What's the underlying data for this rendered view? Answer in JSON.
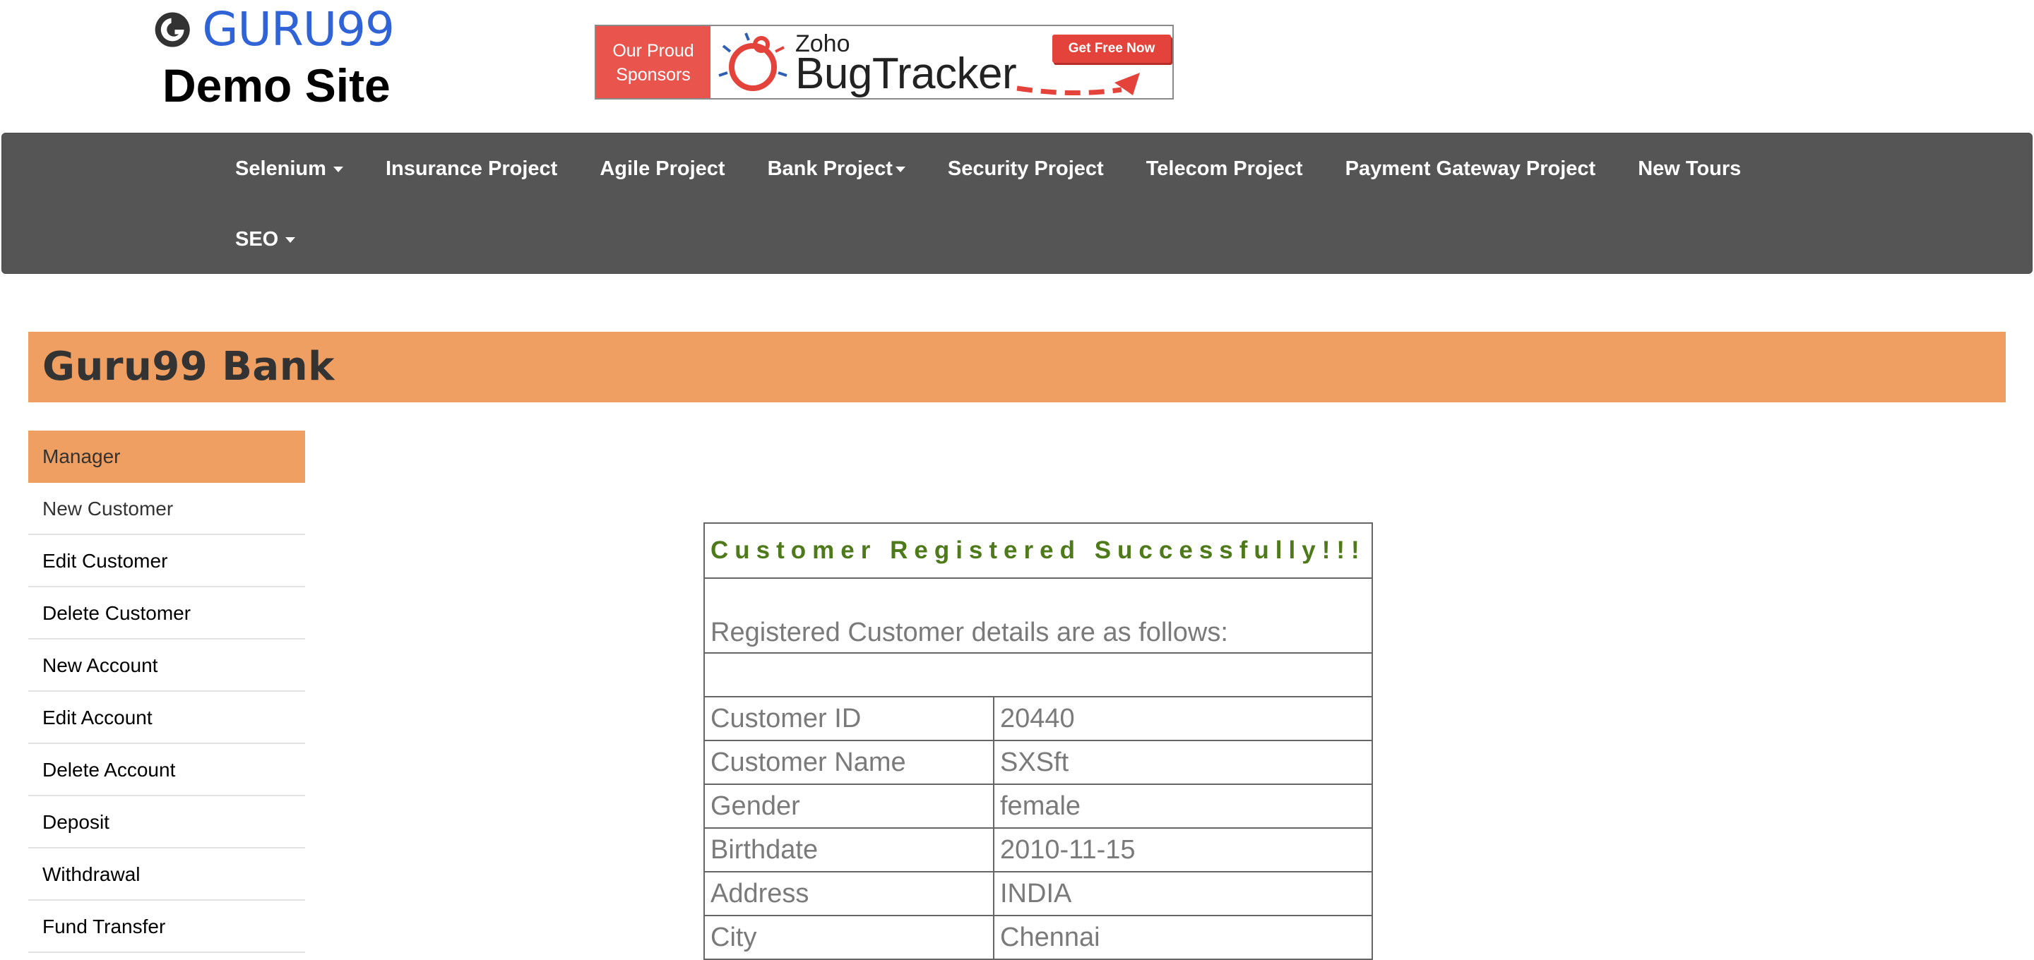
{
  "header": {
    "logo_text": "GURU99",
    "site_name": "Demo Site"
  },
  "banner": {
    "line1": "Our Proud",
    "line2": "Sponsors",
    "brand": "Zoho",
    "product": "BugTracker",
    "cta": "Get Free Now",
    "accent_color": "#e9554d"
  },
  "navbar": {
    "items": [
      {
        "label": "Selenium",
        "has_dropdown": true
      },
      {
        "label": "Insurance Project",
        "has_dropdown": false
      },
      {
        "label": "Agile Project",
        "has_dropdown": false
      },
      {
        "label": "Bank Project",
        "has_dropdown": true
      },
      {
        "label": "Security Project",
        "has_dropdown": false
      },
      {
        "label": "Telecom Project",
        "has_dropdown": false
      },
      {
        "label": "Payment Gateway Project",
        "has_dropdown": false
      },
      {
        "label": "New Tours",
        "has_dropdown": false
      },
      {
        "label": "SEO",
        "has_dropdown": true
      }
    ],
    "background": "#555555"
  },
  "bank": {
    "title": "Guru99 Bank",
    "color": "#ee9f61"
  },
  "sidebar": {
    "items": [
      {
        "label": "Manager"
      },
      {
        "label": "New Customer"
      },
      {
        "label": "Edit Customer"
      },
      {
        "label": "Delete Customer"
      },
      {
        "label": "New Account"
      },
      {
        "label": "Edit Account"
      },
      {
        "label": "Delete Account"
      },
      {
        "label": "Deposit"
      },
      {
        "label": "Withdrawal"
      },
      {
        "label": "Fund Transfer"
      }
    ]
  },
  "result": {
    "heading": "Customer Registered Successfully!!!",
    "intro": "Registered Customer details are as follows:",
    "rows": [
      {
        "label": "Customer ID",
        "value": "20440"
      },
      {
        "label": "Customer Name",
        "value": "SXSft"
      },
      {
        "label": "Gender",
        "value": "female"
      },
      {
        "label": "Birthdate",
        "value": "2010-11-15"
      },
      {
        "label": "Address",
        "value": "INDIA"
      },
      {
        "label": "City",
        "value": "Chennai"
      }
    ],
    "heading_color": "#4f7a1b"
  }
}
